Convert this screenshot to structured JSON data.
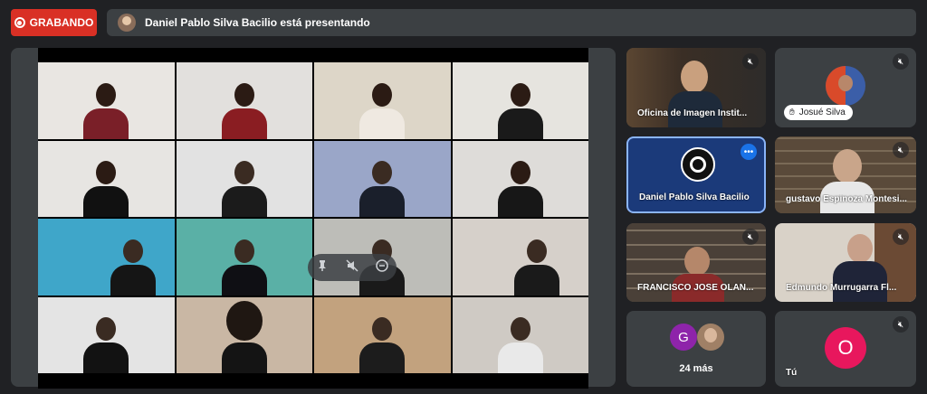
{
  "recording": {
    "label": "GRABANDO"
  },
  "banner": {
    "text": "Daniel Pablo Silva Bacilio está presentando"
  },
  "presentation": {
    "controls": [
      "pin-icon",
      "mute-icon",
      "minimize-icon"
    ]
  },
  "participants": [
    {
      "name": "Oficina de Imagen Instit...",
      "muted": true
    },
    {
      "name": "Josué Silva",
      "muted": true
    },
    {
      "name": "Daniel Pablo Silva Bacilio",
      "muted": false,
      "speaking": true
    },
    {
      "name": "gustavo Espinoza Montesi...",
      "muted": true
    },
    {
      "name": "FRANCISCO JOSE OLAN...",
      "muted": true
    },
    {
      "name": "Edmundo Murrugarra Fl...",
      "muted": true
    }
  ],
  "overflow": {
    "count_label": "24 más",
    "avatar_letter": "G"
  },
  "self": {
    "label": "Tú",
    "avatar_letter": "O"
  },
  "colors": {
    "accent": "#8ab4f8",
    "record": "#d93025",
    "self_avatar": "#e8175d",
    "overflow_avatar": "#8e24aa"
  }
}
